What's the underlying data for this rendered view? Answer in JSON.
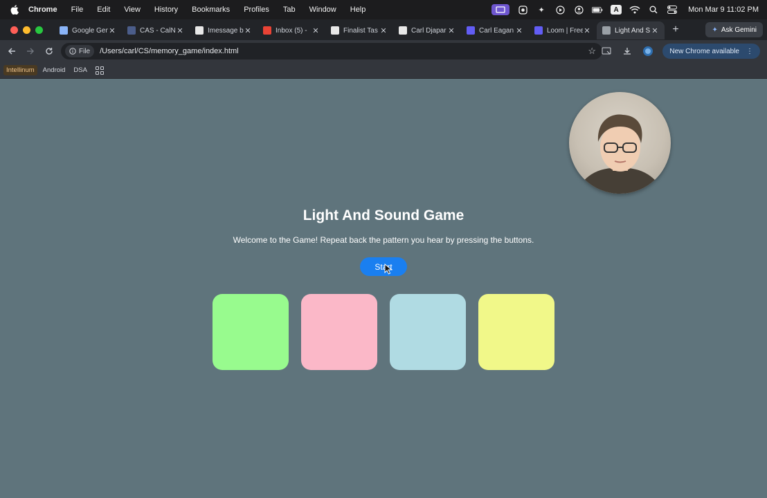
{
  "menubar": {
    "app_name": "Chrome",
    "items": [
      "File",
      "Edit",
      "View",
      "History",
      "Bookmarks",
      "Profiles",
      "Tab",
      "Window",
      "Help"
    ],
    "keyboard_label": "A",
    "clock": "Mon Mar 9  11:02 PM"
  },
  "tabs": [
    {
      "title": "Google Gem",
      "icon": "gemini-icon",
      "color": "#8ab4f8"
    },
    {
      "title": "CAS - CalN",
      "icon": "b-icon",
      "color": "#4b5d8a"
    },
    {
      "title": "Imessage b",
      "icon": "github-icon",
      "color": "#e8e8e8"
    },
    {
      "title": "Inbox (5) -",
      "icon": "gmail-icon",
      "color": "#ea4335"
    },
    {
      "title": "Finalist Tas",
      "icon": "c-icon",
      "color": "#e8e8e8"
    },
    {
      "title": "Carl Djapar",
      "icon": "c-icon",
      "color": "#e8e8e8"
    },
    {
      "title": "Carl Eagan",
      "icon": "loom-icon",
      "color": "#625df5"
    },
    {
      "title": "Loom | Free",
      "icon": "loom-icon",
      "color": "#625df5"
    },
    {
      "title": "Light And S",
      "icon": "globe-icon",
      "color": "#9aa0a6"
    }
  ],
  "ask_gemini_label": "Ask Gemini",
  "toolbar": {
    "file_chip_label": "File",
    "url": "/Users/carl/CS/memory_game/index.html",
    "update_label": "New Chrome available"
  },
  "bookmarks": [
    "Intellinum",
    "Android",
    "DSA"
  ],
  "page": {
    "title": "Light And Sound Game",
    "subtitle": "Welcome to the Game! Repeat back the pattern you hear by pressing the buttons.",
    "start_label": "Start",
    "pad_colors": [
      "#98fb8e",
      "#fbb8c8",
      "#b0dbe3",
      "#f1f889"
    ]
  },
  "colors": {
    "page_background": "#5f747c",
    "start_button": "#1a7ff0"
  }
}
